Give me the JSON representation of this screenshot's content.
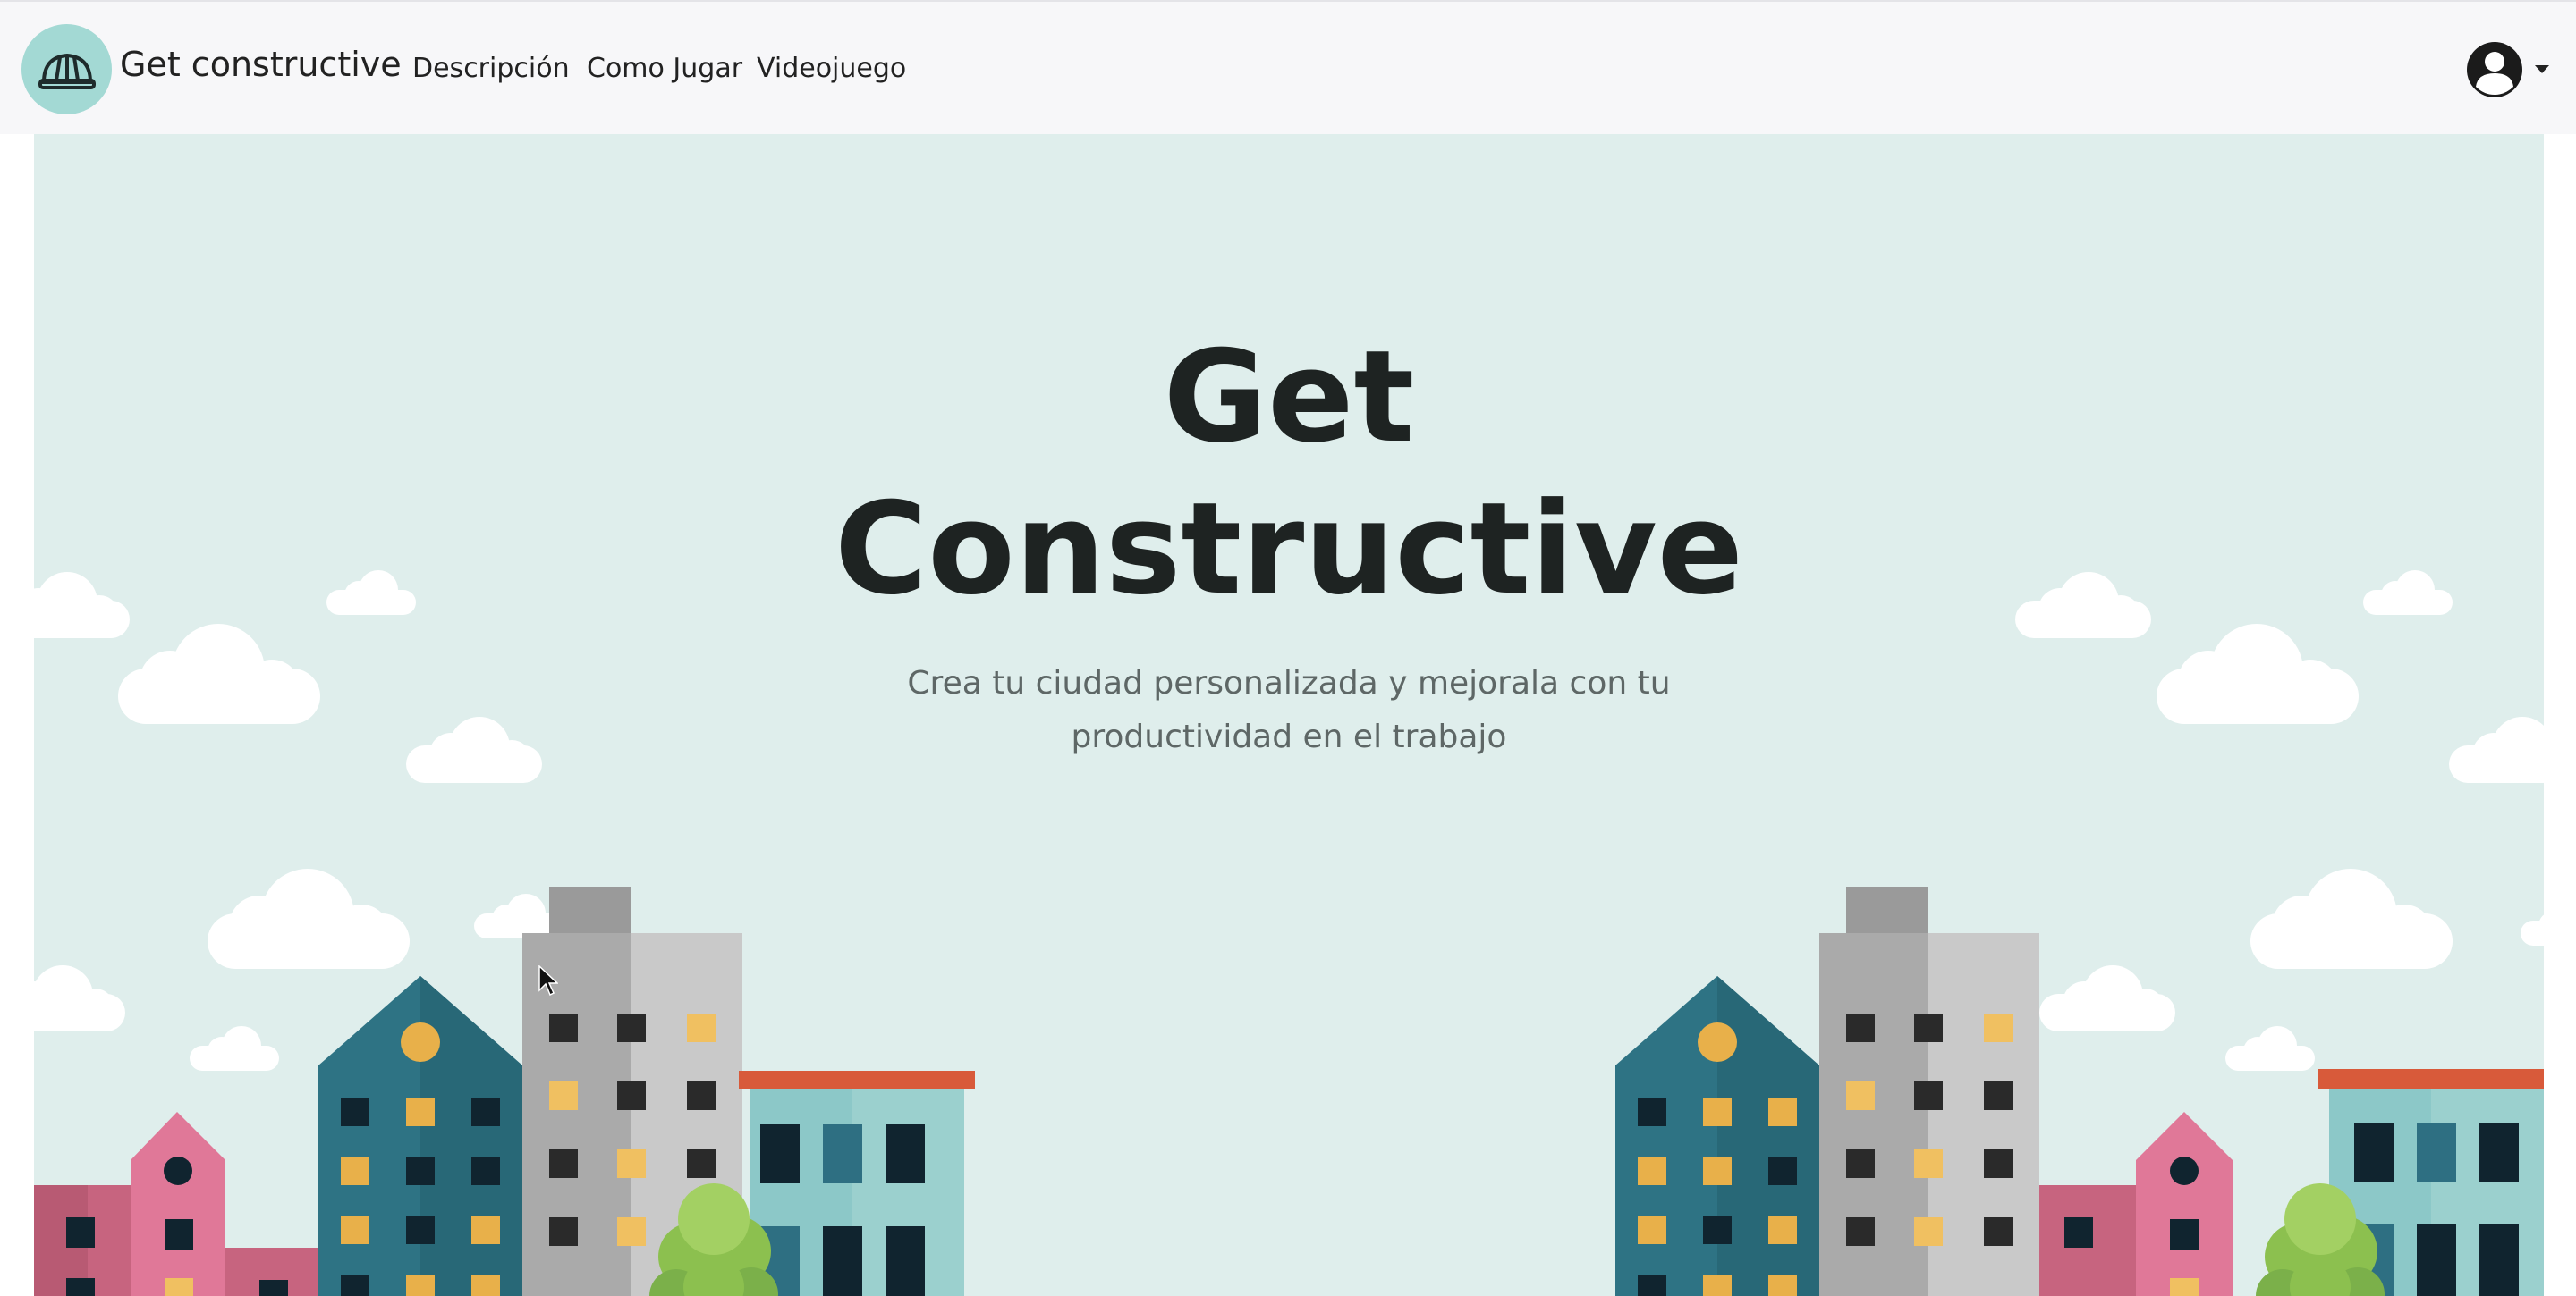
{
  "brand": {
    "name": "Get constructive",
    "logo_icon": "hardhat-icon"
  },
  "nav": {
    "links": [
      {
        "label": "Descripción"
      },
      {
        "label": "Como Jugar"
      },
      {
        "label": "Videojuego"
      }
    ]
  },
  "user_menu": {
    "icon": "user-avatar-icon",
    "caret_icon": "caret-down-icon"
  },
  "hero": {
    "title_line1": "Get",
    "title_line2": "Constructive",
    "subtitle_line1": "Crea tu ciudad personalizada y mejorala con tu",
    "subtitle_line2": "productividad en el trabajo"
  },
  "colors": {
    "navbar_bg": "#f7f7f9",
    "logo_bg": "#a3d9d4",
    "hero_bg": "#dfeeec",
    "title": "#1e2322",
    "subtitle": "#5e6766"
  }
}
